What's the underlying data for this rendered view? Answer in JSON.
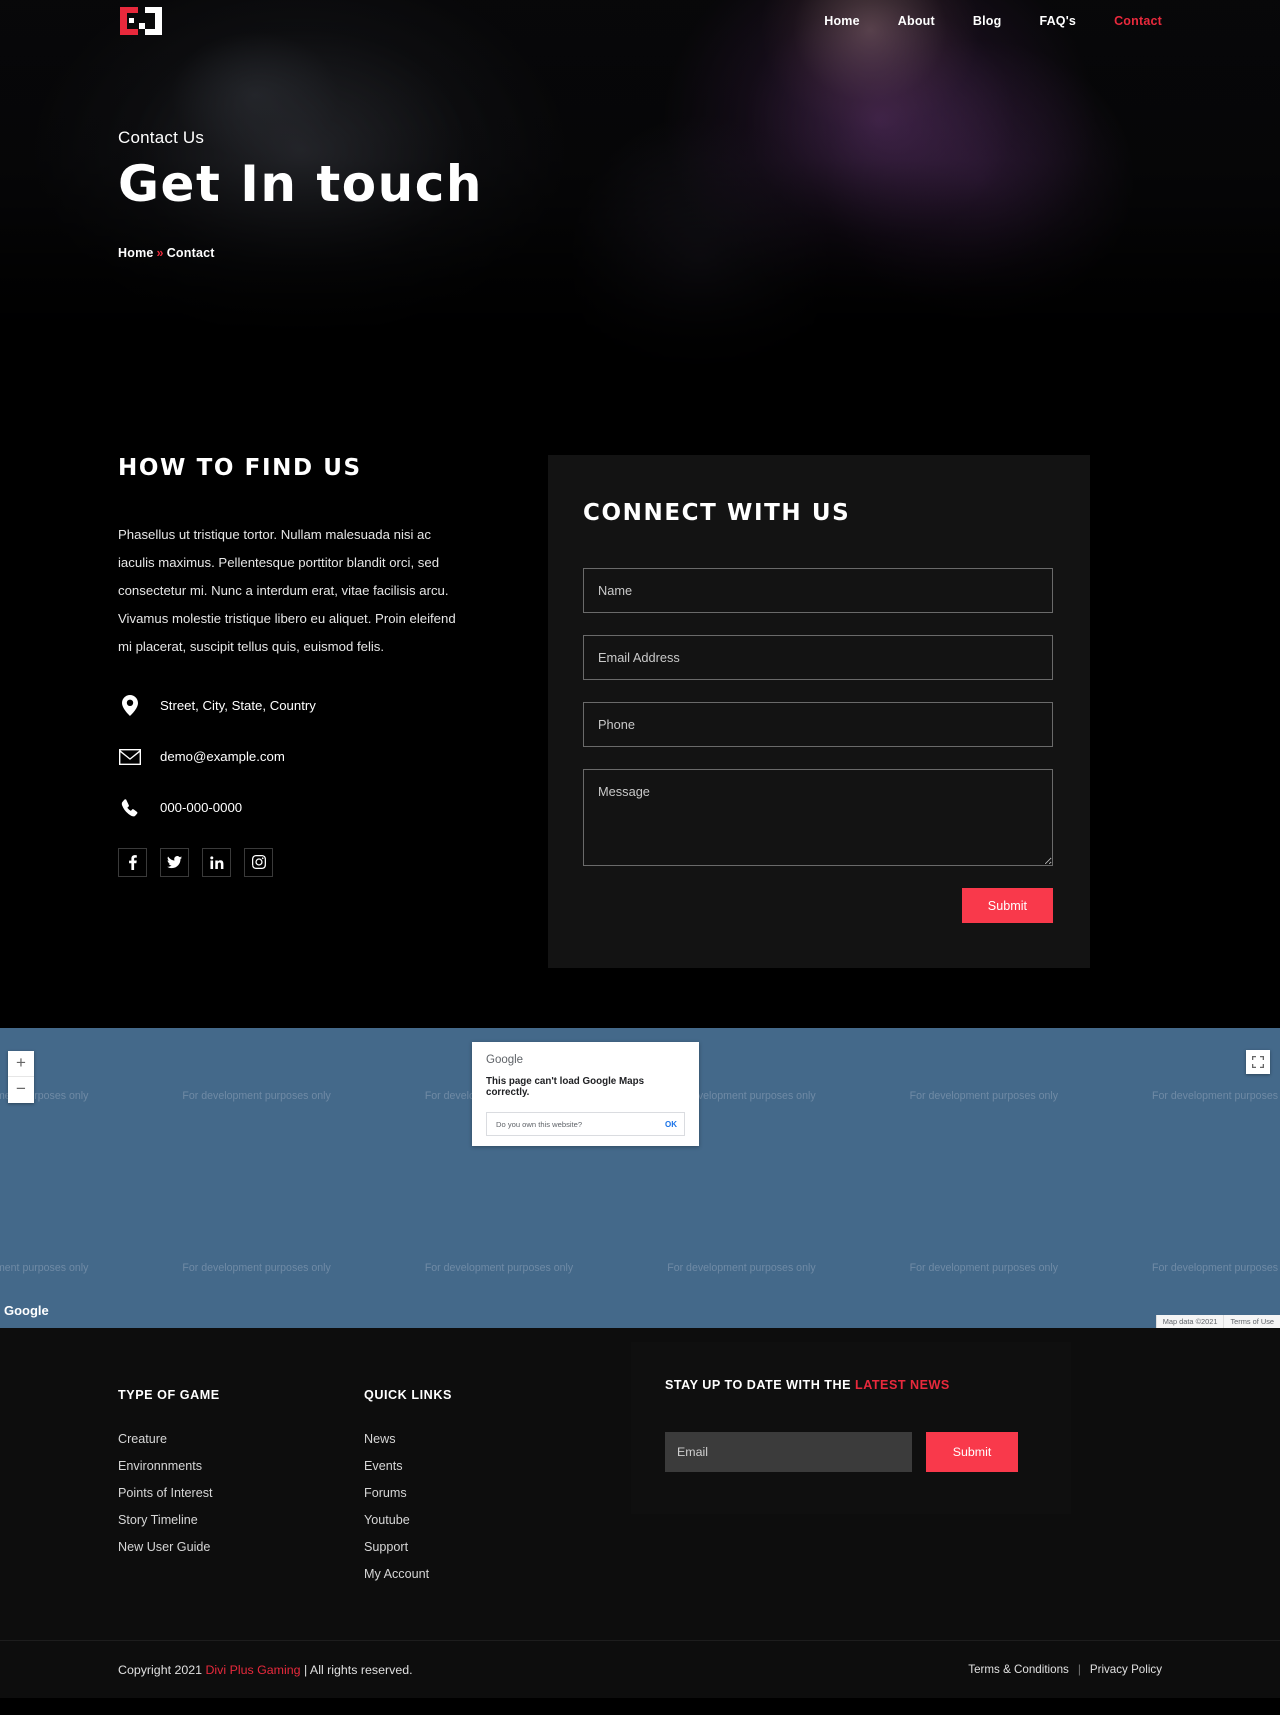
{
  "brand": {
    "logo_icon": "gd-bracket-logo",
    "accent_red": "#e8293c",
    "button_red": "#f9394b"
  },
  "nav": {
    "items": [
      {
        "label": "Home",
        "active": false
      },
      {
        "label": "About",
        "active": false
      },
      {
        "label": "Blog",
        "active": false
      },
      {
        "label": "FAQ's",
        "active": false
      },
      {
        "label": "Contact",
        "active": true
      }
    ]
  },
  "hero": {
    "eyebrow": "Contact Us",
    "title": "Get In touch",
    "breadcrumb": {
      "home": "Home",
      "separator": "»",
      "current": "Contact"
    }
  },
  "find_us": {
    "title": "HOW TO FIND US",
    "paragraph": "Phasellus ut tristique tortor. Nullam malesuada nisi ac iaculis maximus. Pellentesque porttitor blandit orci, sed consectetur mi. Nunc a interdum erat, vitae facilisis arcu. Vivamus molestie tristique libero eu aliquet. Proin eleifend mi placerat, suscipit tellus quis, euismod felis.",
    "address": "Street, City, State, Country",
    "email": "demo@example.com",
    "phone": "000-000-0000",
    "socials": [
      {
        "name": "facebook",
        "glyph": "f"
      },
      {
        "name": "twitter",
        "glyph": "t"
      },
      {
        "name": "linkedin",
        "glyph": "in"
      },
      {
        "name": "instagram",
        "glyph": "ig"
      }
    ]
  },
  "contact_form": {
    "title": "CONNECT WITH US",
    "fields": {
      "name": {
        "placeholder": "Name",
        "value": ""
      },
      "email": {
        "placeholder": "Email Address",
        "value": ""
      },
      "phone": {
        "placeholder": "Phone",
        "value": ""
      },
      "message": {
        "placeholder": "Message",
        "value": ""
      }
    },
    "submit_label": "Submit"
  },
  "map": {
    "watermark": "For development purposes only",
    "zoom_in": "+",
    "zoom_out": "−",
    "brand": "Google",
    "dialog": {
      "brand": "Google",
      "message": "This page can't load Google Maps correctly.",
      "question": "Do you own this website?",
      "ok": "OK"
    },
    "credit_data": "Map data ©2021",
    "credit_terms": "Terms of Use"
  },
  "footer": {
    "columns": [
      {
        "title": "TYPE OF GAME",
        "links": [
          "Creature",
          "Environnments",
          "Points of Interest",
          "Story Timeline",
          "New User Guide"
        ]
      },
      {
        "title": "QUICK LINKS",
        "links": [
          "News",
          "Events",
          "Forums",
          "Youtube",
          "Support",
          "My Account"
        ]
      }
    ],
    "newsletter": {
      "title_plain": "STAY UP TO DATE WITH THE ",
      "title_highlight": "LATEST NEWS",
      "email_placeholder": "Email",
      "email_value": "",
      "submit_label": "Submit"
    },
    "copyright": {
      "prefix": "Copyright 2021 ",
      "brand": "Divi Plus Gaming",
      "suffix": " | All rights reserved."
    },
    "legal": {
      "terms": "Terms & Conditions",
      "divider": "|",
      "privacy": "Privacy Policy"
    }
  }
}
